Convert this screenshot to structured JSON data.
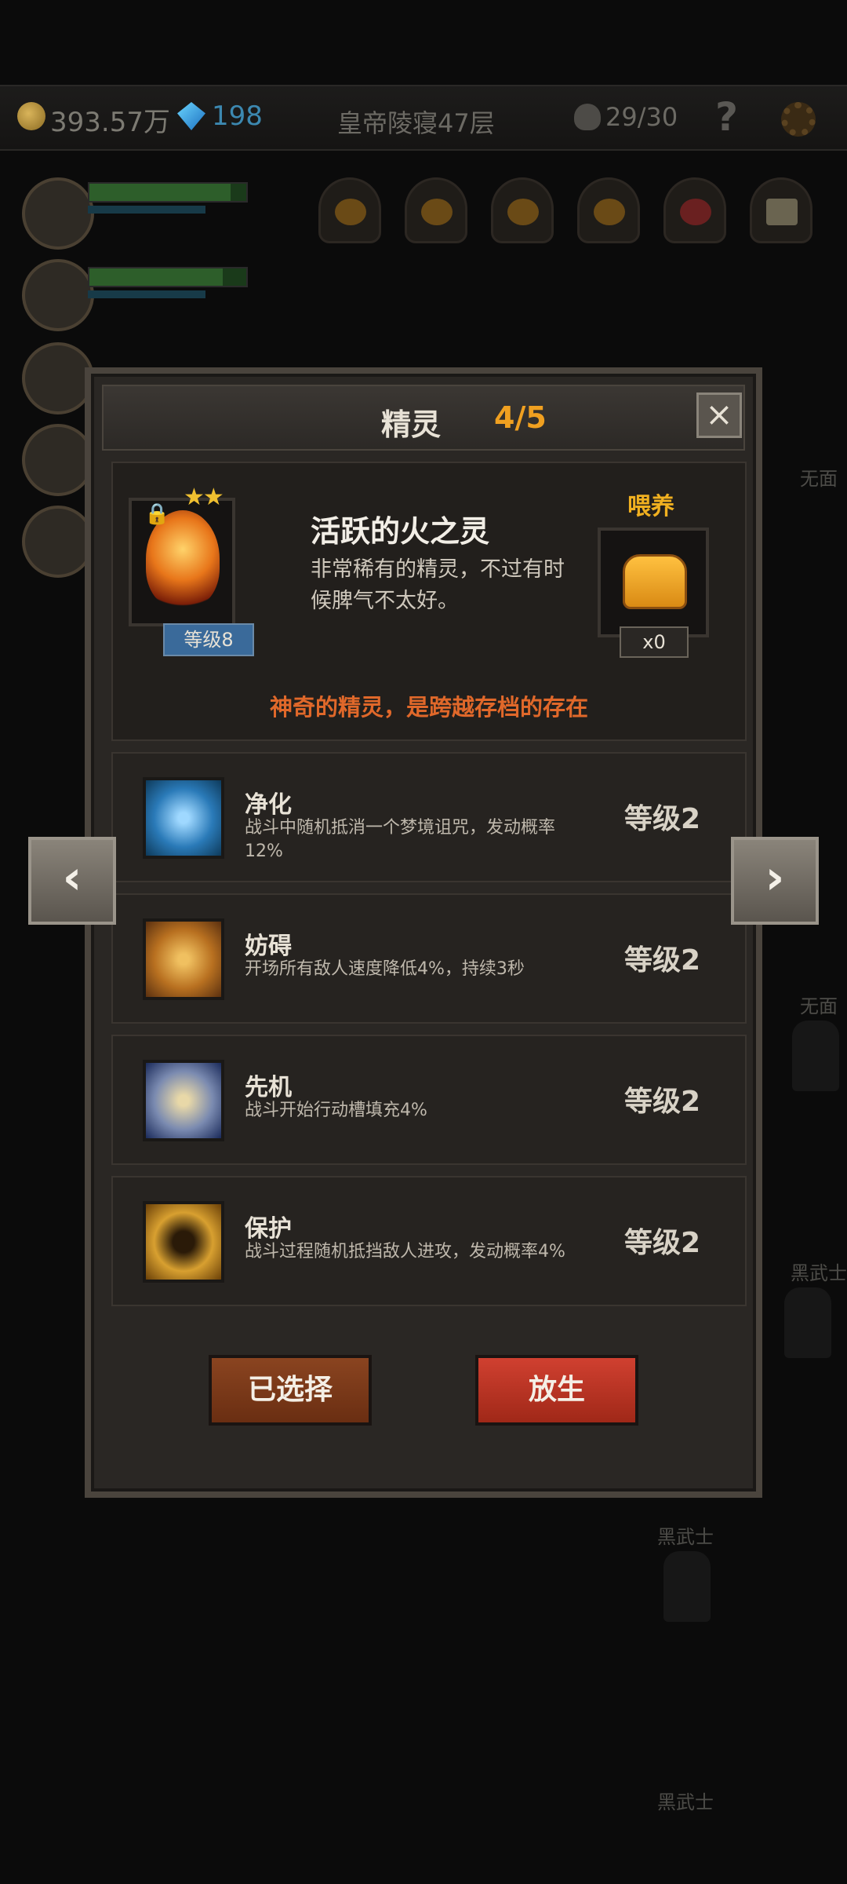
{
  "top_bar": {
    "gold": "393.57万",
    "diamonds": "198",
    "location": "皇帝陵寝47层",
    "kills": "29/30",
    "help": "?"
  },
  "enemies": [
    "无面",
    "无面",
    "黑武士",
    "黑武士",
    "黑武士"
  ],
  "modal": {
    "title": "精灵",
    "count": "4/5",
    "close": "×",
    "spirit": {
      "name": "活跃的火之灵",
      "description": "非常稀有的精灵，不过有时候脾气不太好。",
      "stars": "★★",
      "level": "等级8"
    },
    "feed": {
      "label": "喂养",
      "count": "x0"
    },
    "tagline": "神奇的精灵，是跨越存档的存在",
    "skills": [
      {
        "name": "净化",
        "desc": "战斗中随机抵消一个梦境诅咒，发动概率12%",
        "level": "等级2"
      },
      {
        "name": "妨碍",
        "desc": "开场所有敌人速度降低4%，持续3秒",
        "level": "等级2"
      },
      {
        "name": "先机",
        "desc": "战斗开始行动槽填充4%",
        "level": "等级2"
      },
      {
        "name": "保护",
        "desc": "战斗过程随机抵挡敌人进攻，发动概率4%",
        "level": "等级2"
      }
    ],
    "buttons": {
      "selected": "已选择",
      "release": "放生"
    },
    "nav": {
      "prev": "‹",
      "next": "›"
    }
  },
  "colors": {
    "accent_gold": "#f0a020",
    "tagline_orange": "#e0682a",
    "selected_button": "#7a3a1a",
    "release_button": "#b83222"
  },
  "icons": [
    "coin-icon",
    "diamond-icon",
    "skull-icon",
    "gear-icon",
    "lock-icon",
    "bread-icon",
    "blue-flower-icon",
    "chained-boot-icon",
    "leopard-icon",
    "golden-shield-figure-icon"
  ]
}
